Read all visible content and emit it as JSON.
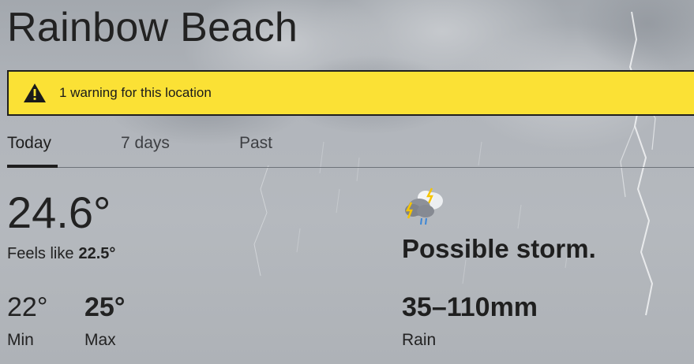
{
  "location": {
    "name": "Rainbow Beach"
  },
  "warning": {
    "text": "1 warning for this location",
    "icon": "warning-triangle-icon"
  },
  "tabs": [
    {
      "label": "Today",
      "active": true
    },
    {
      "label": "7 days",
      "active": false
    },
    {
      "label": "Past",
      "active": false
    }
  ],
  "current": {
    "temperature": "24.6°",
    "feels_like_label": "Feels like",
    "feels_like_value": "22.5°"
  },
  "range": {
    "min_value": "22°",
    "min_label": "Min",
    "max_value": "25°",
    "max_label": "Max"
  },
  "forecast": {
    "icon": "storm-cloud-icon",
    "summary": "Possible storm.",
    "rain_value": "35–110mm",
    "rain_label": "Rain"
  },
  "colors": {
    "warning_bg": "#fbe135",
    "text": "#1e1e1e"
  }
}
